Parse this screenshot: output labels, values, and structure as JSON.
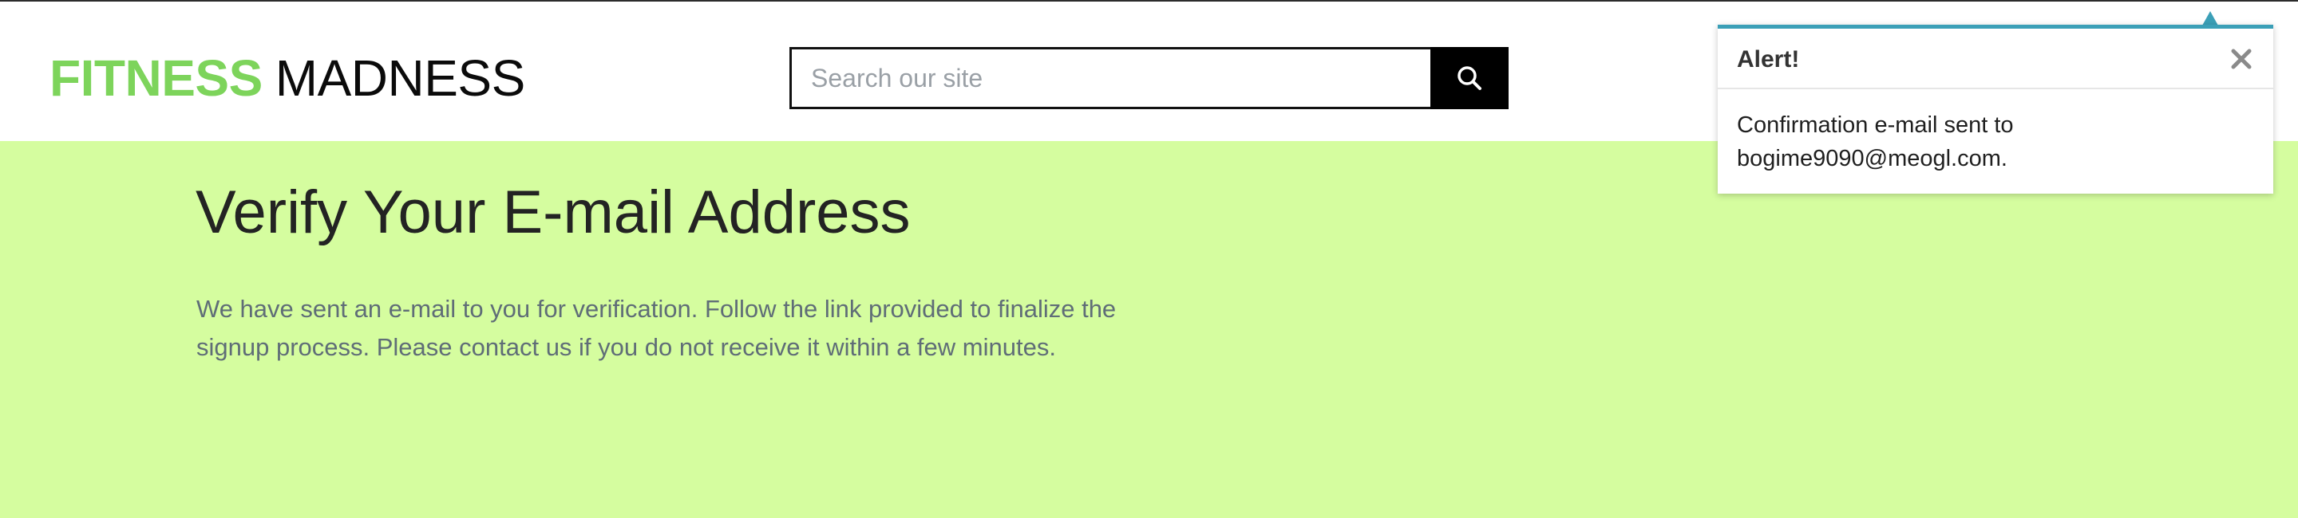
{
  "logo": {
    "accent": "FITNESS",
    "main": "MADNESS"
  },
  "search": {
    "placeholder": "Search our site",
    "value": "",
    "button_icon": "search-icon"
  },
  "page": {
    "title": "Verify Your E-mail Address",
    "body": "We have sent an e-mail to you for verification. Follow the link provided to finalize the signup process. Please contact us if you do not receive it within a few minutes."
  },
  "alert": {
    "title": "Alert!",
    "message": "Confirmation e-mail sent to bogime9090@meogl.com.",
    "close_icon": "close-icon"
  },
  "colors": {
    "brand_green": "#7dd45b",
    "content_background": "#d5fd9f",
    "alert_accent": "#3b9fb7"
  }
}
